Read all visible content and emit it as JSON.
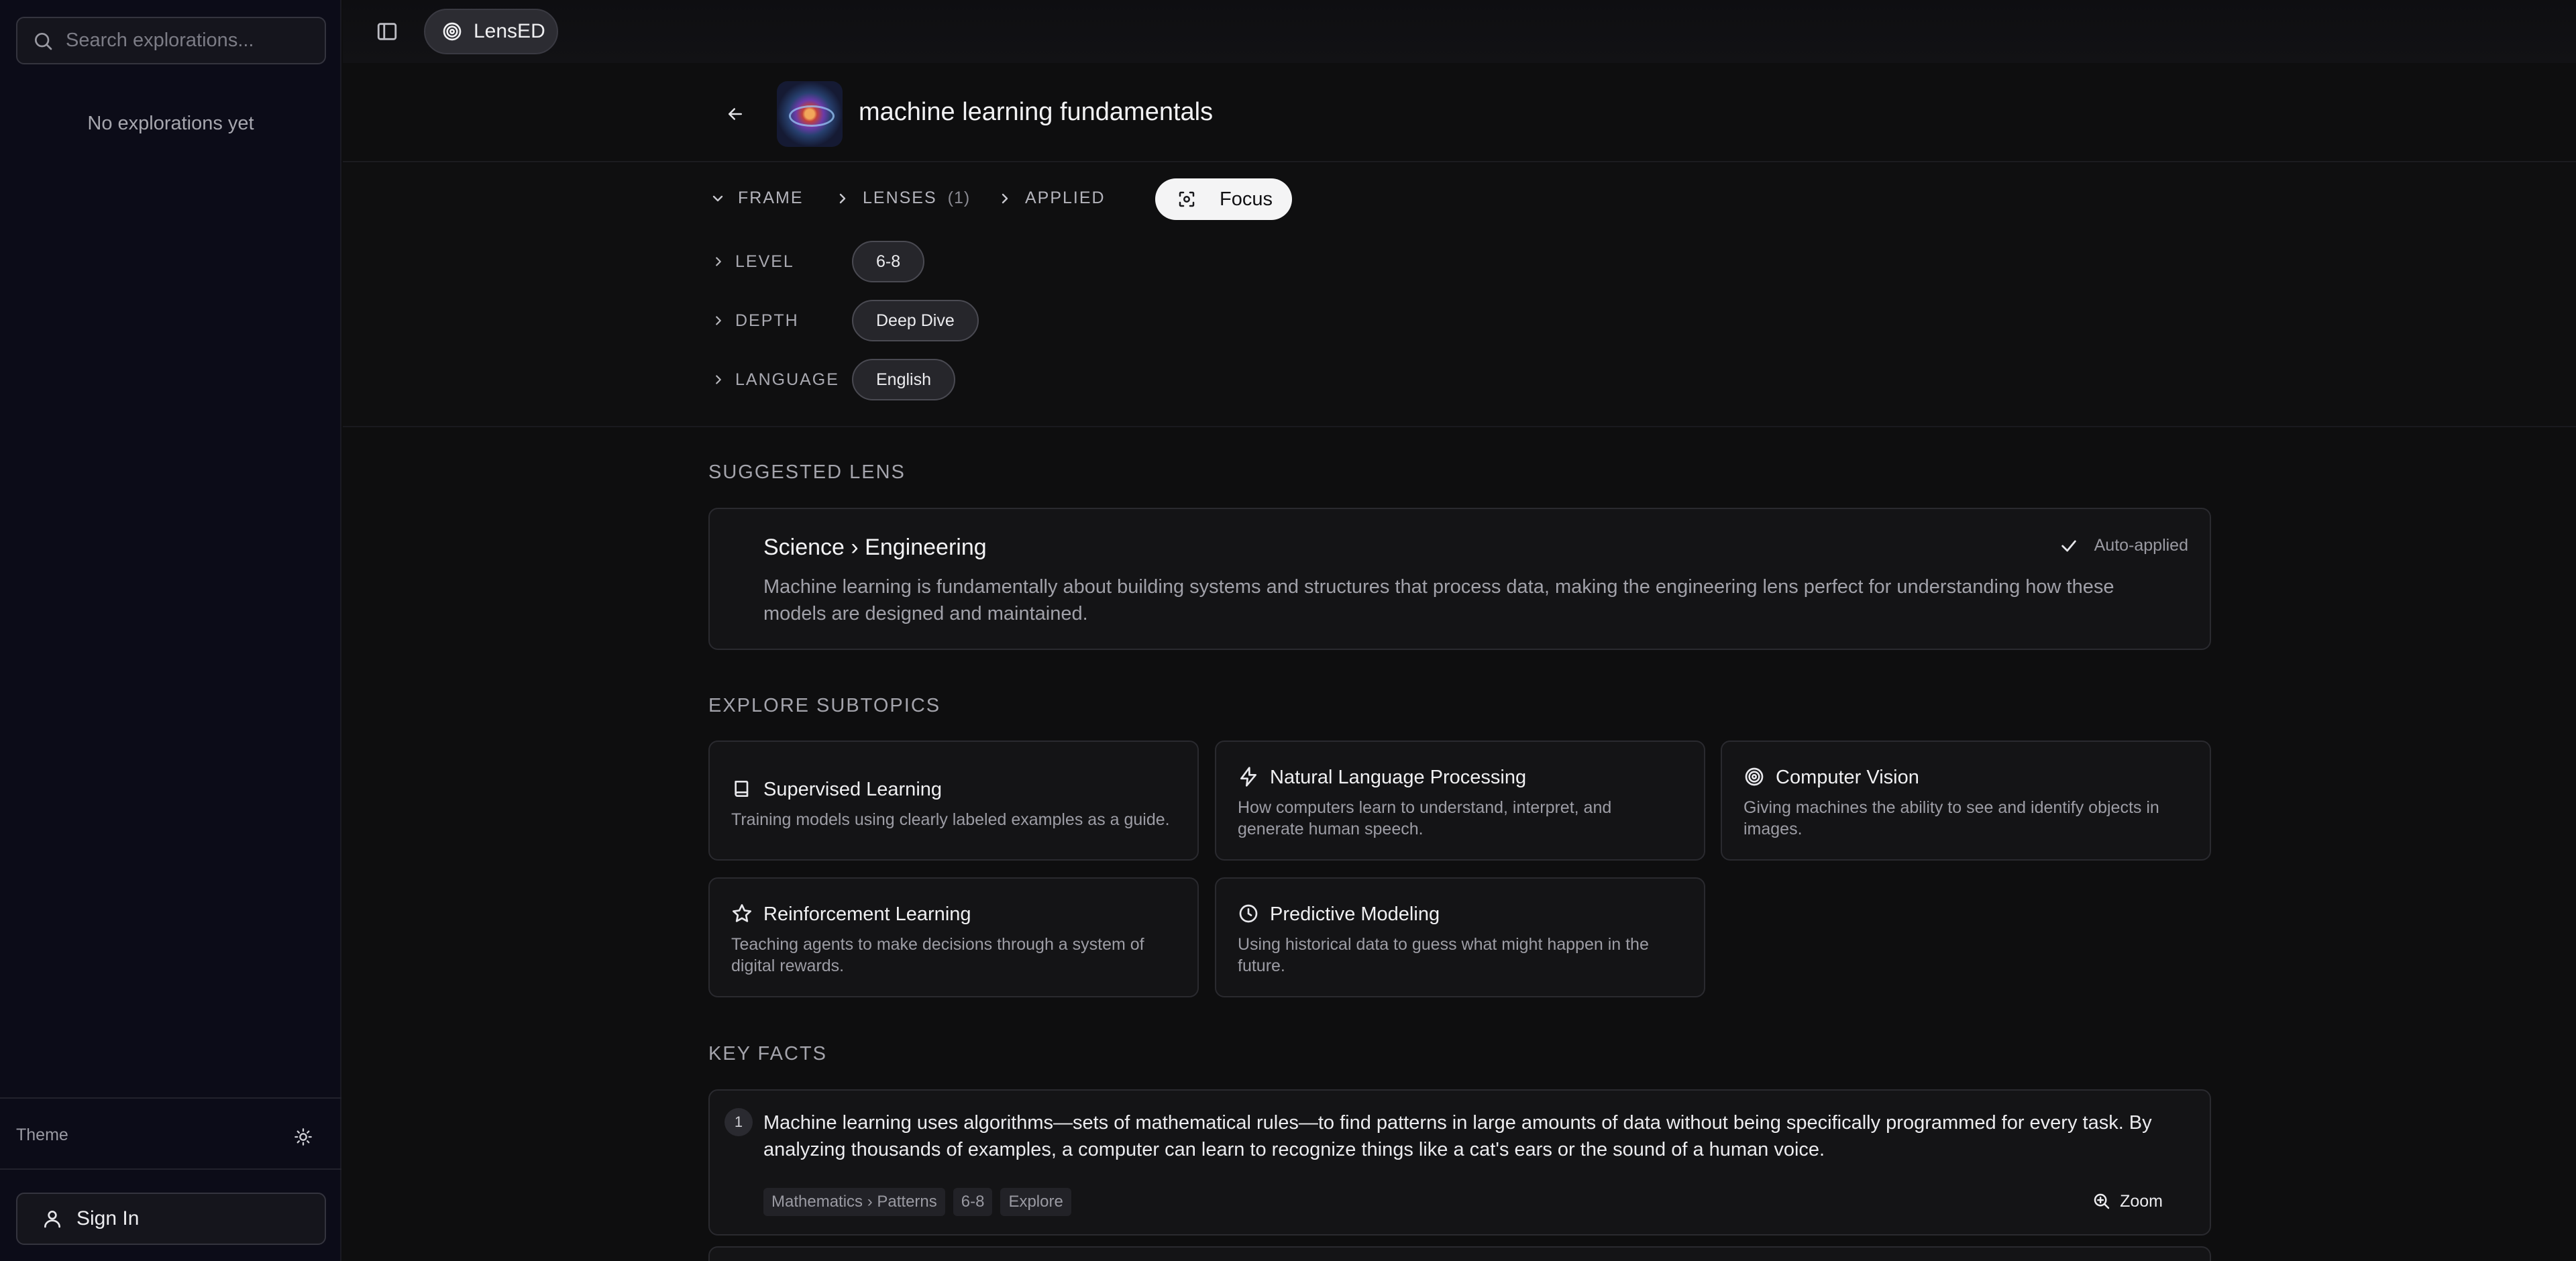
{
  "sidebar": {
    "search_placeholder": "Search explorations...",
    "empty_message": "No explorations yet",
    "theme_label": "Theme",
    "theme_icon": "sun-icon",
    "sign_in_label": "Sign In"
  },
  "topbar": {
    "brand": "LensED",
    "brand_icon": "target-icon"
  },
  "header": {
    "title": "machine learning fundamentals"
  },
  "frame_tabs": {
    "frame": "FRAME",
    "lenses": "LENSES",
    "lenses_count": "(1)",
    "applied": "APPLIED",
    "focus": "Focus"
  },
  "frame_rows": [
    {
      "label": "LEVEL",
      "value": "6-8"
    },
    {
      "label": "DEPTH",
      "value": "Deep Dive"
    },
    {
      "label": "LANGUAGE",
      "value": "English"
    }
  ],
  "suggested_lens": {
    "section_title": "SUGGESTED LENS",
    "title": "Science › Engineering",
    "status": "Auto-applied",
    "description": "Machine learning is fundamentally about building systems and structures that process data, making the engineering lens perfect for understanding how these models are designed and maintained."
  },
  "subtopics": {
    "section_title": "EXPLORE SUBTOPICS",
    "items": [
      {
        "icon": "book-icon",
        "title": "Supervised Learning",
        "description": "Training models using clearly labeled examples as a guide."
      },
      {
        "icon": "lightning-icon",
        "title": "Natural Language Processing",
        "description": "How computers learn to understand, interpret, and generate human speech."
      },
      {
        "icon": "target-icon",
        "title": "Computer Vision",
        "description": "Giving machines the ability to see and identify objects in images."
      },
      {
        "icon": "star-icon",
        "title": "Reinforcement Learning",
        "description": "Teaching agents to make decisions through a system of digital rewards."
      },
      {
        "icon": "clock-icon",
        "title": "Predictive Modeling",
        "description": "Using historical data to guess what might happen in the future."
      }
    ]
  },
  "key_facts": {
    "section_title": "KEY FACTS",
    "items": [
      {
        "number": "1",
        "text": "Machine learning uses algorithms—sets of mathematical rules—to find patterns in large amounts of data without being specifically programmed for every task. By analyzing thousands of examples, a computer can learn to recognize things like a cat's ears or the sound of a human voice.",
        "tags": [
          "Mathematics › Patterns",
          "6-8",
          "Explore"
        ],
        "action": "Zoom"
      }
    ]
  },
  "colors": {
    "background": "#0e0e0f",
    "sidebar": "#0c0c18",
    "card": "#141416",
    "accent_button": "#f4f4f5"
  }
}
